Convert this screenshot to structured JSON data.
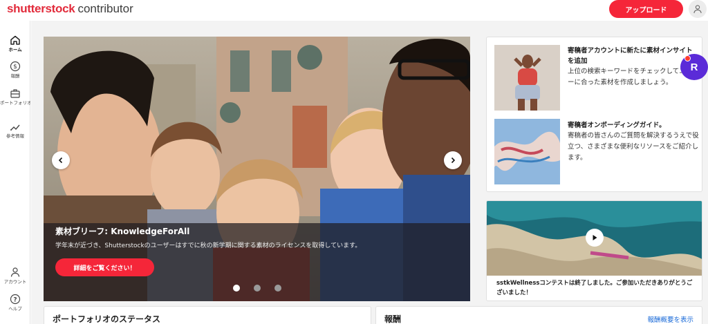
{
  "header": {
    "brand": "shutterstock",
    "product": "contributor",
    "upload_label": "アップロード",
    "accent_color": "#f52639"
  },
  "sidebar": {
    "top_items": [
      {
        "label": "ホーム",
        "icon": "home-icon",
        "active": true
      },
      {
        "label": "報酬",
        "icon": "dollar-icon",
        "active": false
      },
      {
        "label": "ポートフォリオ",
        "icon": "briefcase-icon",
        "active": false
      },
      {
        "label": "参考情報",
        "icon": "insights-icon",
        "active": false
      }
    ],
    "bottom_items": [
      {
        "label": "アカウント",
        "icon": "user-icon"
      },
      {
        "label": "ヘルプ",
        "icon": "help-icon"
      }
    ]
  },
  "hero": {
    "title": "素材ブリーフ: KnowledgeForAll",
    "description": "学年末が近づき、Shutterstockのユーザーはすでに秋の新学期に関する素材のライセンスを取得しています。",
    "cta_label": "詳細をご覧ください！",
    "slide_count": 3,
    "active_slide": 1
  },
  "tips": [
    {
      "title": "寄稿者アカウントに新たに素材インサイトを追加",
      "body": "上位の検索キーワードをチェックしてユーザーに合った素材を作成しましょう。"
    },
    {
      "title": "寄稿者オンボーディングガイド。",
      "body": "寄稿者の皆さんのご質問を解決するうえで役立つ、さまざまな便利なリソースをご紹介します。"
    }
  ],
  "video_card": {
    "caption": "sstkWellnessコンテストは終了しました。ご参加いただきありがとうございました！"
  },
  "floating_badge": {
    "letter": "R",
    "color": "#5b2bd8"
  },
  "panels": {
    "portfolio_status_title": "ポートフォリオのステータス",
    "earnings_title": "報酬",
    "earnings_link": "報酬概要を表示"
  }
}
